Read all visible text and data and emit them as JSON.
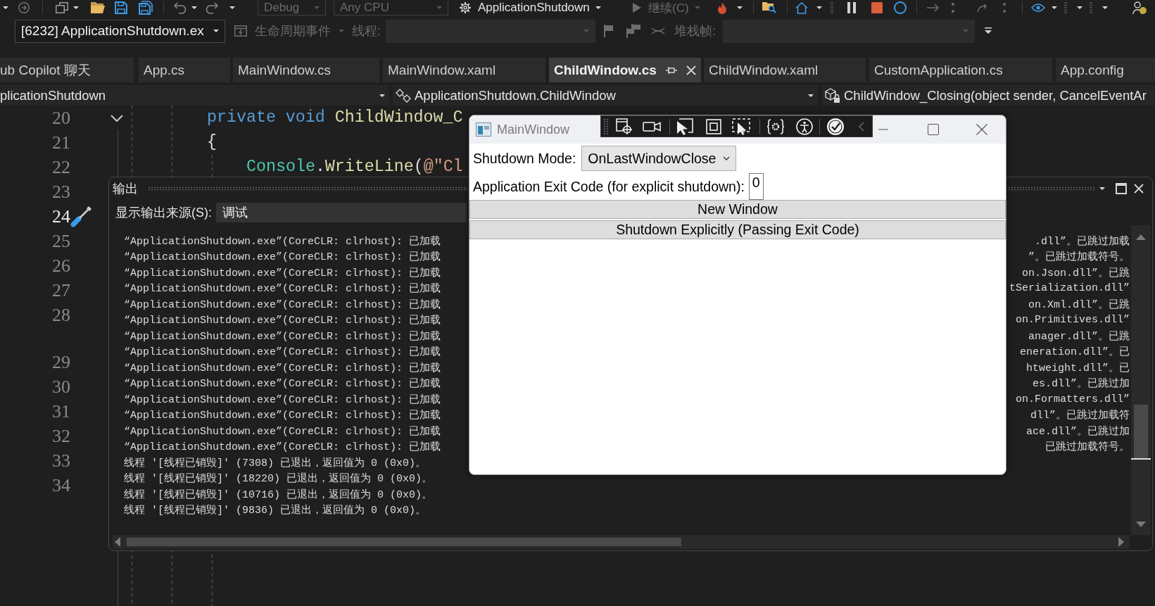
{
  "toolbar": {
    "items": [
      {
        "kind": "combo",
        "label": "Debug",
        "disabled": true
      },
      {
        "kind": "combo",
        "label": "Any CPU",
        "disabled": true
      },
      {
        "kind": "button",
        "label": "ApplicationShutdown",
        "disabled": false
      },
      {
        "kind": "button",
        "label": "继续(C)",
        "disabled": true
      }
    ]
  },
  "debug_location": {
    "process": "[6232] ApplicationShutdown.ex",
    "lifecycle_events": {
      "label": "生命周期事件",
      "disabled": true
    },
    "thread": {
      "label": "线程:",
      "disabled": true
    },
    "stack_frame": {
      "label": "堆栈帧:",
      "disabled": true
    }
  },
  "tabs": [
    {
      "label": "ub Copilot 聊天",
      "selected": false
    },
    {
      "label": "App.cs",
      "selected": false
    },
    {
      "label": "MainWindow.cs",
      "selected": false
    },
    {
      "label": "MainWindow.xaml",
      "selected": false
    },
    {
      "label": "ChildWindow.cs",
      "selected": true
    },
    {
      "label": "ChildWindow.xaml",
      "selected": false
    },
    {
      "label": "CustomApplication.cs",
      "selected": false
    },
    {
      "label": "App.config",
      "selected": false
    }
  ],
  "navigation_bar": {
    "project": "plicationShutdown",
    "type": "ApplicationShutdown.ChildWindow",
    "member": "ChildWindow_Closing(object sender, CancelEventAr"
  },
  "editor": {
    "lines": [
      {
        "number": "20",
        "current": false,
        "foldable": true,
        "gap_before": false,
        "tokens": [
          {
            "kind": "keyword",
            "text": "private "
          },
          {
            "kind": "keyword",
            "text": "void "
          },
          {
            "kind": "method",
            "text": "ChildWindow_C"
          }
        ]
      },
      {
        "number": "21",
        "current": false,
        "foldable": false,
        "gap_before": false,
        "tokens": [
          {
            "kind": "plain",
            "text": "{"
          }
        ],
        "children": [
          {
            "number": "22",
            "current": false,
            "foldable": false,
            "gap_before": false,
            "tokens": [
              {
                "kind": "type",
                "text": "Console"
              },
              {
                "kind": "plain",
                "text": "."
              },
              {
                "kind": "method",
                "text": "WriteLine"
              },
              {
                "kind": "plain",
                "text": "("
              },
              {
                "kind": "string",
                "text": "@\"Cl"
              }
            ]
          }
        ]
      },
      {
        "number": "23",
        "current": false,
        "foldable": false,
        "gap_before": false
      },
      {
        "number": "24",
        "current": true,
        "foldable": false,
        "gap_before": false
      },
      {
        "number": "25",
        "current": false,
        "foldable": false,
        "gap_before": false
      },
      {
        "number": "26",
        "current": false,
        "foldable": false,
        "gap_before": false
      },
      {
        "number": "27",
        "current": false,
        "foldable": false,
        "gap_before": false
      },
      {
        "number": "28",
        "current": false,
        "foldable": false,
        "gap_before": false
      },
      {
        "number": "29",
        "current": false,
        "foldable": false,
        "gap_before": true
      },
      {
        "number": "30",
        "current": false,
        "foldable": false,
        "gap_before": false
      },
      {
        "number": "31",
        "current": false,
        "foldable": false,
        "gap_before": false
      },
      {
        "number": "32",
        "current": false,
        "foldable": false,
        "gap_before": false
      },
      {
        "number": "33",
        "current": false,
        "foldable": false,
        "gap_before": false
      },
      {
        "number": "34",
        "current": false,
        "foldable": false,
        "gap_before": false
      }
    ]
  },
  "output": {
    "title": "输出",
    "source_label": "显示输出来源(S):",
    "source": "调试",
    "lines": [
      {
        "text": "“ApplicationShutdown.exe”(CoreCLR: clrhost): 已加载",
        "tail": ".dll”。已跳过加载"
      },
      {
        "text": "“ApplicationShutdown.exe”(CoreCLR: clrhost): 已加载",
        "tail": "”。已跳过加载符号。"
      },
      {
        "text": "“ApplicationShutdown.exe”(CoreCLR: clrhost): 已加载",
        "tail": "on.Json.dll”。已跳"
      },
      {
        "text": "“ApplicationShutdown.exe”(CoreCLR: clrhost): 已加载",
        "tail": "tSerialization.dll”"
      },
      {
        "text": "“ApplicationShutdown.exe”(CoreCLR: clrhost): 已加载",
        "tail": "on.Xml.dll”。已跳"
      },
      {
        "text": "“ApplicationShutdown.exe”(CoreCLR: clrhost): 已加载",
        "tail": "on.Primitives.dll”"
      },
      {
        "text": "“ApplicationShutdown.exe”(CoreCLR: clrhost): 已加载",
        "tail": "anager.dll”。已跳"
      },
      {
        "text": "“ApplicationShutdown.exe”(CoreCLR: clrhost): 已加载",
        "tail": "eneration.dll”。已"
      },
      {
        "text": "“ApplicationShutdown.exe”(CoreCLR: clrhost): 已加载",
        "tail": "htweight.dll”。已"
      },
      {
        "text": "“ApplicationShutdown.exe”(CoreCLR: clrhost): 已加载",
        "tail": "es.dll”。已跳过加"
      },
      {
        "text": "“ApplicationShutdown.exe”(CoreCLR: clrhost): 已加载",
        "tail": "on.Formatters.dll”"
      },
      {
        "text": "“ApplicationShutdown.exe”(CoreCLR: clrhost): 已加载",
        "tail": "dll”。已跳过加载符"
      },
      {
        "text": "“ApplicationShutdown.exe”(CoreCLR: clrhost): 已加载",
        "tail": "ace.dll”。已跳过加"
      },
      {
        "text": "“ApplicationShutdown.exe”(CoreCLR: clrhost): 已加载",
        "tail": "已跳过加载符号。"
      },
      {
        "text": "线程 '[线程已销毁]' (7308) 已退出，返回值为 0 (0x0)。"
      },
      {
        "text": "线程 '[线程已销毁]' (18220) 已退出，返回值为 0 (0x0)。"
      },
      {
        "text": "线程 '[线程已销毁]' (10716) 已退出，返回值为 0 (0x0)。"
      },
      {
        "text": "线程 '[线程已销毁]' (9836) 已退出，返回值为 0 (0x0)。"
      }
    ]
  },
  "app_window": {
    "title": "MainWindow",
    "shutdown_mode_label": "Shutdown Mode:",
    "shutdown_mode": "OnLastWindowClose",
    "exit_code_label": "Application Exit Code (for explicit shutdown):",
    "exit_code": "0",
    "buttons": [
      "New Window",
      "Shutdown Explicitly (Passing Exit Code)"
    ]
  }
}
